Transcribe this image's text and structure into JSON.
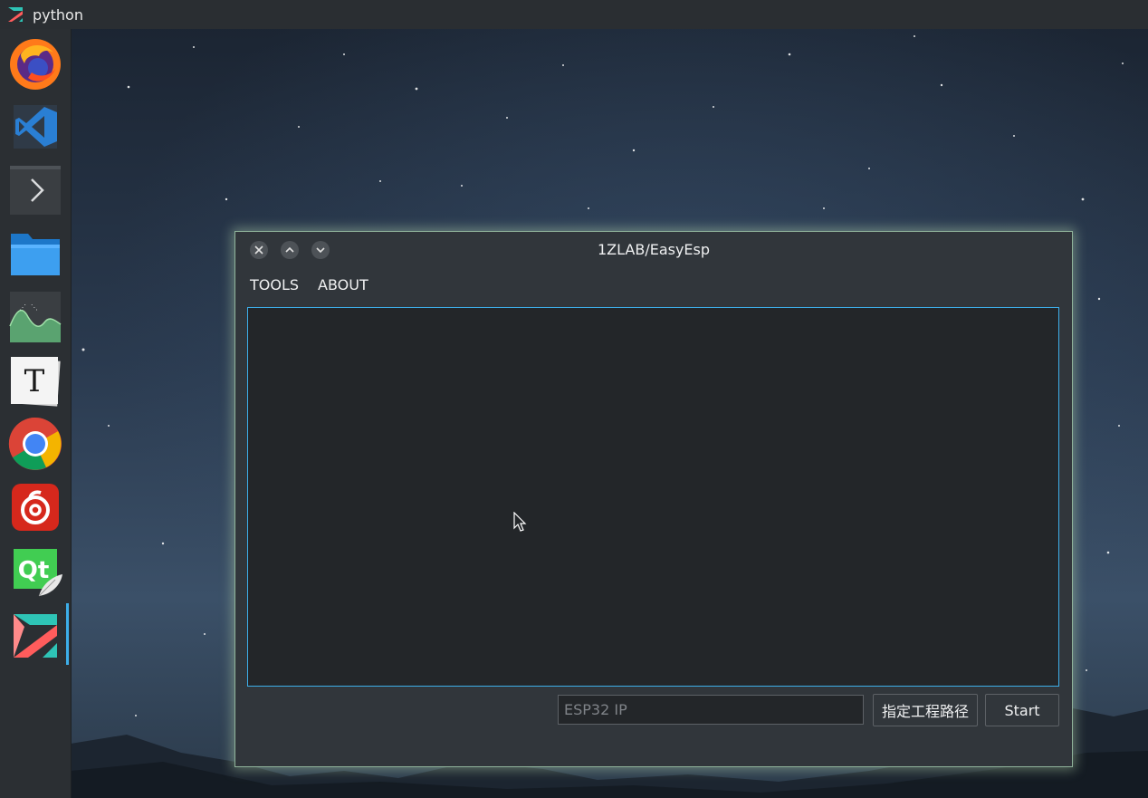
{
  "top_panel": {
    "app_name": "python",
    "app_icon": "1zlab-logo-icon"
  },
  "dock": {
    "items": [
      {
        "name": "firefox",
        "icon": "firefox-icon"
      },
      {
        "name": "vscode",
        "icon": "vscode-icon"
      },
      {
        "name": "terminal",
        "icon": "terminal-icon"
      },
      {
        "name": "files",
        "icon": "folder-icon"
      },
      {
        "name": "system-monitor",
        "icon": "system-monitor-icon"
      },
      {
        "name": "typora",
        "icon": "typora-icon"
      },
      {
        "name": "chrome",
        "icon": "chrome-icon"
      },
      {
        "name": "netease-music",
        "icon": "netease-music-icon"
      },
      {
        "name": "qt-designer",
        "icon": "qt-icon"
      },
      {
        "name": "1zlab",
        "icon": "1zlab-logo-icon",
        "active": true
      }
    ],
    "typora_letter": "T",
    "qt_text": "Qt"
  },
  "window": {
    "title": "1ZLAB/EasyEsp",
    "menu": [
      "TOOLS",
      "ABOUT"
    ],
    "output_text": "",
    "ip_input": {
      "value": "",
      "placeholder": "ESP32 IP"
    },
    "path_button": "指定工程路径",
    "start_button": "Start"
  },
  "colors": {
    "accent": "#3daee9",
    "window_bg": "#31363b",
    "panel_bg": "#2a2e32",
    "glow": "#b4d2aa"
  }
}
